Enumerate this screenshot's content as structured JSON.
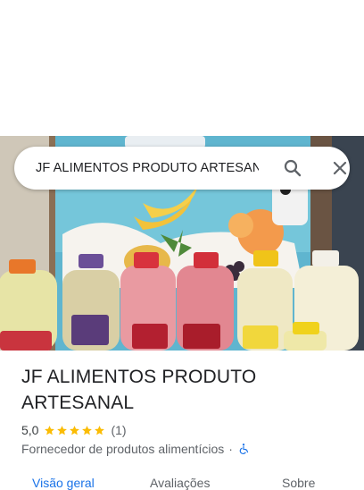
{
  "search": {
    "query": "JF ALIMENTOS PRODUTO ARTESAN",
    "search_icon": "search-icon",
    "close_icon": "close-icon"
  },
  "photo": {
    "description_icon": "place-photo"
  },
  "place": {
    "title": "JF ALIMENTOS PRODUTO ARTESANAL",
    "rating": "5,0",
    "stars": 5,
    "review_count": "(1)",
    "category": "Fornecedor de produtos alimentícios",
    "separator": "·",
    "accessibility_icon": "wheelchair-icon"
  },
  "tabs": [
    {
      "label": "Visão geral",
      "active": true
    },
    {
      "label": "Avaliações",
      "active": false
    },
    {
      "label": "Sobre",
      "active": false
    }
  ],
  "colors": {
    "accent": "#1a73e8",
    "star": "#fbbc04",
    "text_primary": "#202124",
    "text_secondary": "#5f6368"
  }
}
